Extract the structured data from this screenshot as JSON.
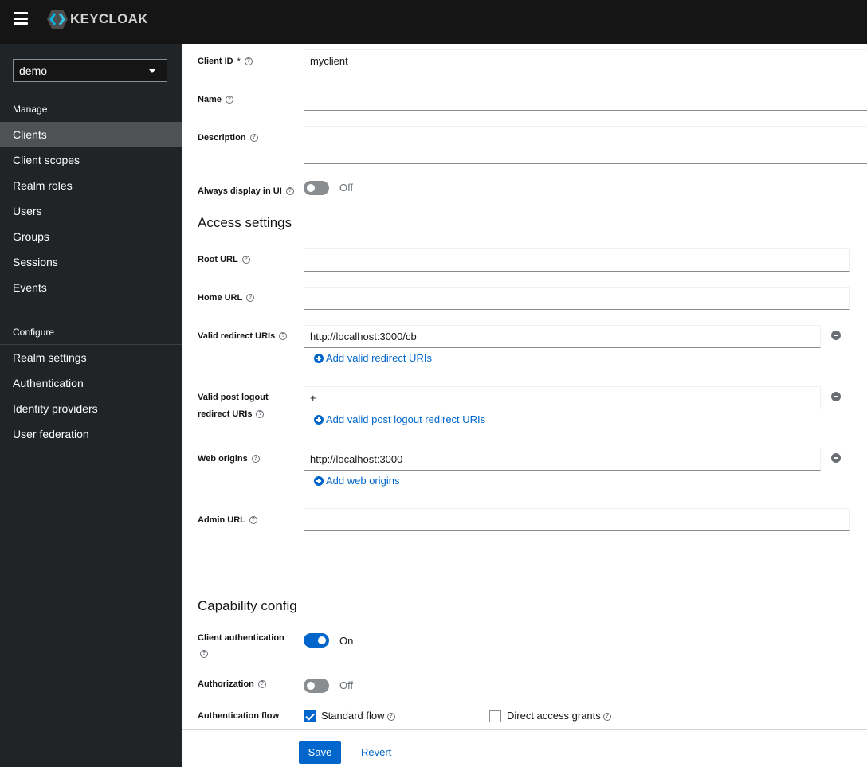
{
  "masthead": {
    "logo_text": "KEYCLOAK"
  },
  "sidebar": {
    "realm": "demo",
    "sections": [
      {
        "title": "Manage",
        "items": [
          "Clients",
          "Client scopes",
          "Realm roles",
          "Users",
          "Groups",
          "Sessions",
          "Events"
        ]
      },
      {
        "title": "Configure",
        "items": [
          "Realm settings",
          "Authentication",
          "Identity providers",
          "User federation"
        ]
      }
    ],
    "active": "Clients"
  },
  "form": {
    "client_id": {
      "label": "Client ID",
      "required": "*",
      "value": "myclient"
    },
    "name": {
      "label": "Name",
      "value": ""
    },
    "description": {
      "label": "Description",
      "value": ""
    },
    "always_display": {
      "label": "Always display in UI",
      "state": "Off"
    },
    "access_settings": {
      "title": "Access settings",
      "root_url": {
        "label": "Root URL",
        "value": ""
      },
      "home_url": {
        "label": "Home URL",
        "value": ""
      },
      "valid_redirect": {
        "label": "Valid redirect URIs",
        "value": "http://localhost:3000/cb",
        "add_label": "Add valid redirect URIs"
      },
      "post_logout": {
        "label_line1": "Valid post logout",
        "label_line2": "redirect URIs",
        "value": "+",
        "add_label": "Add valid post logout redirect URIs"
      },
      "web_origins": {
        "label": "Web origins",
        "value": "http://localhost:3000",
        "add_label": "Add web origins"
      },
      "admin_url": {
        "label": "Admin URL",
        "value": ""
      }
    },
    "capability": {
      "title": "Capability config",
      "client_auth": {
        "label": "Client authentication",
        "state": "On"
      },
      "authorization": {
        "label": "Authorization",
        "state": "Off"
      },
      "auth_flow": {
        "label": "Authentication flow",
        "standard_flow": "Standard flow",
        "direct_access": "Direct access grants"
      }
    }
  },
  "footer": {
    "save": "Save",
    "revert": "Revert"
  },
  "help_glyph": "?"
}
